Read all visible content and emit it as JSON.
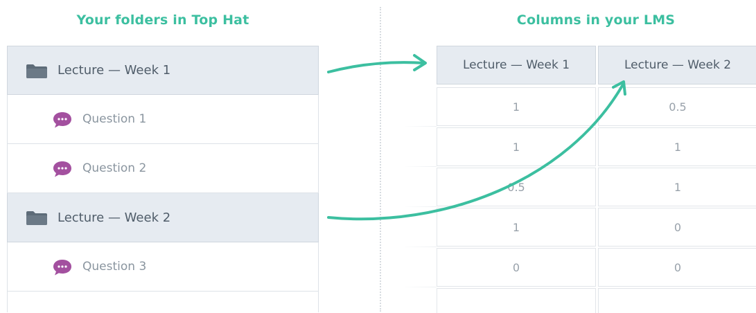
{
  "headings": {
    "left": "Your folders in Top Hat",
    "right": "Columns in your LMS"
  },
  "tree": {
    "folders": [
      {
        "label": "Lecture — Week 1",
        "questions": [
          "Question 1",
          "Question 2"
        ]
      },
      {
        "label": "Lecture — Week 2",
        "questions": [
          "Question 3"
        ]
      }
    ]
  },
  "table": {
    "columns": [
      "Lecture — Week 1",
      "Lecture — Week 2"
    ],
    "rows": [
      [
        "1",
        "0.5"
      ],
      [
        "1",
        "1"
      ],
      [
        "0.5",
        "1"
      ],
      [
        "1",
        "0"
      ],
      [
        "0",
        "0"
      ]
    ]
  },
  "colors": {
    "accent": "#3cbfa0",
    "folder_bg": "#e6ebf1",
    "folder_icon": "#5d6b78",
    "question_icon": "#a3509f"
  },
  "icons": {
    "folder": "folder-icon",
    "question": "chat-bubble-icon"
  }
}
